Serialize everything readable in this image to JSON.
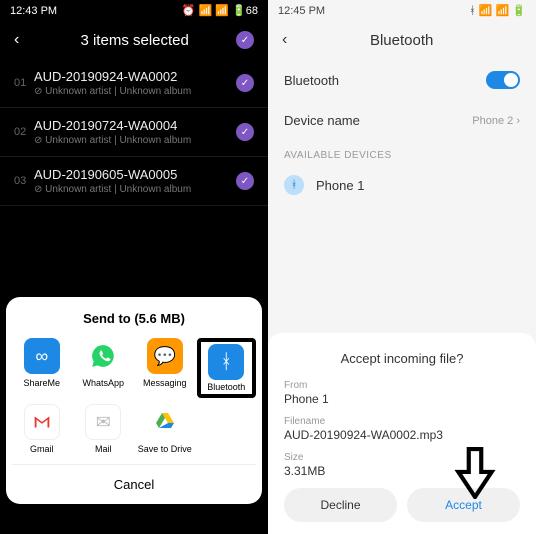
{
  "left": {
    "status_time": "12:43 PM",
    "status_icons": "⏰ 📶 📶 🔋68",
    "header_title": "3 items selected",
    "items": [
      {
        "idx": "01",
        "title": "AUD-20190924-WA0002",
        "sub": "⊘ Unknown artist | Unknown album"
      },
      {
        "idx": "02",
        "title": "AUD-20190724-WA0004",
        "sub": "⊘ Unknown artist | Unknown album"
      },
      {
        "idx": "03",
        "title": "AUD-20190605-WA0005",
        "sub": "⊘ Unknown artist | Unknown album"
      }
    ],
    "sheet_title": "Send to (5.6 MB)",
    "apps": {
      "shareme": "ShareMe",
      "whatsapp": "WhatsApp",
      "messaging": "Messaging",
      "bluetooth": "Bluetooth",
      "gmail": "Gmail",
      "mail": "Mail",
      "drive": "Save to Drive"
    },
    "cancel": "Cancel"
  },
  "right": {
    "status_time": "12:45 PM",
    "status_icons": "ᚼ 📶 📶 🔋",
    "header_title": "Bluetooth",
    "rows": {
      "bluetooth_label": "Bluetooth",
      "device_name_label": "Device name",
      "device_name_value": "Phone 2"
    },
    "section_label": "AVAILABLE DEVICES",
    "device1": "Phone 1",
    "sheet": {
      "title": "Accept incoming file?",
      "from_label": "From",
      "from_value": "Phone 1",
      "filename_label": "Filename",
      "filename_value": "AUD-20190924-WA0002.mp3",
      "size_label": "Size",
      "size_value": "3.31MB",
      "decline": "Decline",
      "accept": "Accept"
    }
  },
  "colors": {
    "accent_blue": "#1e88e5",
    "accent_purple": "#7e57c2"
  }
}
